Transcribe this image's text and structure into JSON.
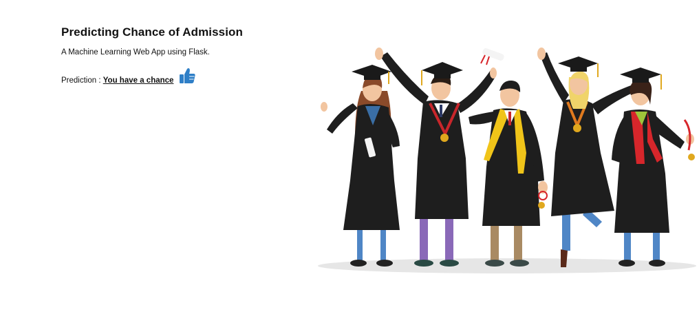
{
  "header": {
    "title": "Predicting Chance of Admission",
    "subtitle": "A Machine Learning Web App using Flask."
  },
  "prediction": {
    "label": "Prediction :",
    "result": "You have a chance",
    "icon": "thumbs-up-icon",
    "icon_color": "#2f7fc7"
  },
  "illustration": {
    "subject": "graduates-illustration"
  }
}
